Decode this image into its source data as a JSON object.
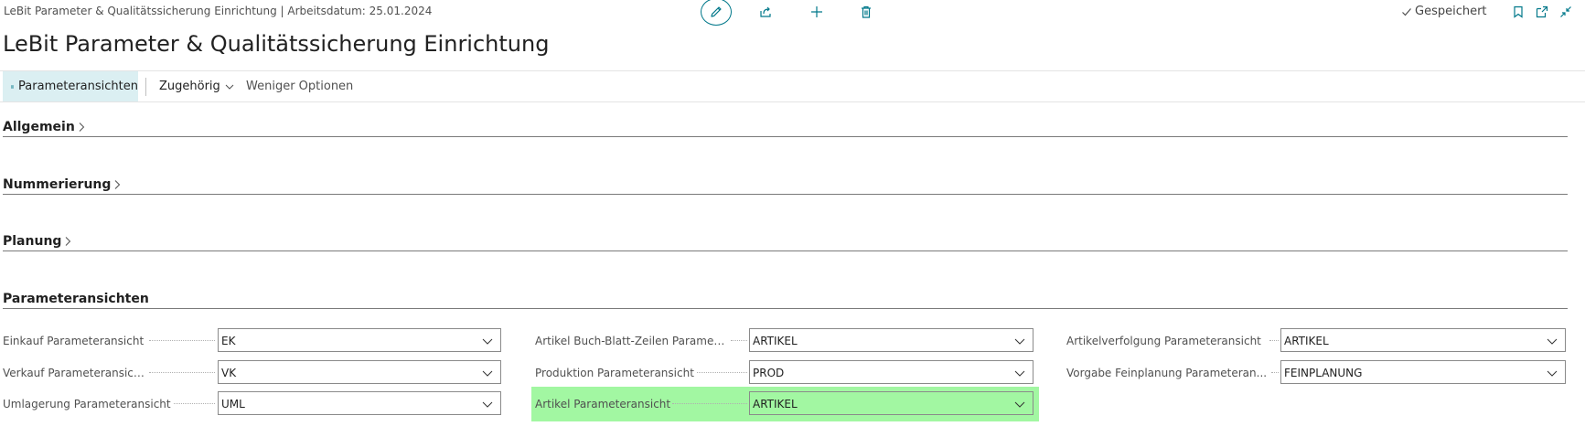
{
  "window": {
    "title": "LeBit Parameter & Qualitätssicherung Einrichtung | Arbeitsdatum: 25.01.2024",
    "saved_label": "Gespeichert"
  },
  "page": {
    "title": "LeBit Parameter & Qualitätssicherung Einrichtung"
  },
  "actionbar": {
    "parameteransichten": "Parameteransichten",
    "zugehoerig": "Zugehörig",
    "weniger_optionen": "Weniger Optionen"
  },
  "sections": {
    "allgemein": "Allgemein",
    "nummerierung": "Nummerierung",
    "planung": "Planung",
    "parameteransichten": "Parameteransichten"
  },
  "fields": {
    "einkauf": {
      "label": "Einkauf Parameteransicht",
      "value": "EK"
    },
    "verkauf": {
      "label": "Verkauf Parameteransicht",
      "value": "VK"
    },
    "umlagerung": {
      "label": "Umlagerung Parameteransicht",
      "value": "UML"
    },
    "artikel_buch": {
      "label": "Artikel Buch-Blatt-Zeilen Parameter...",
      "value": "ARTIKEL"
    },
    "produktion": {
      "label": "Produktion Parameteransicht",
      "value": "PROD"
    },
    "artikel": {
      "label": "Artikel Parameteransicht",
      "value": "ARTIKEL"
    },
    "artikelverfolgung": {
      "label": "Artikelverfolgung Parameteransicht",
      "value": "ARTIKEL"
    },
    "vorgabe_feinplanung": {
      "label": "Vorgabe Feinplanung Parameteran...",
      "value": "FEINPLANUNG"
    }
  },
  "colors": {
    "accent": "#00788a",
    "highlight": "#a2f7a2",
    "active_action_bg": "#dbeff2"
  },
  "icons": {
    "edit": "pencil-icon",
    "share": "share-icon",
    "new": "plus-icon",
    "delete": "trash-icon",
    "saved": "check-icon",
    "bookmark": "bookmark-icon",
    "open_new_window": "open-in-new-window-icon",
    "collapse": "collapse-icon",
    "grid": "grid-icon"
  }
}
